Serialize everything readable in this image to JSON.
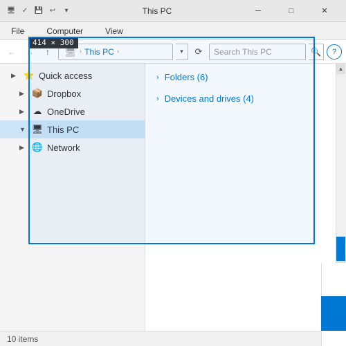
{
  "titleBar": {
    "title": "This PC",
    "minBtn": "─",
    "maxBtn": "□",
    "closeBtn": "✕"
  },
  "ribbon": {
    "tabs": [
      "File",
      "Computer",
      "View"
    ]
  },
  "addressBar": {
    "backLabel": "←",
    "forwardLabel": "→",
    "upLabel": "↑",
    "pathIcon": "🖥",
    "thisPcLabel": "This PC",
    "chevron": ">",
    "dropdownArrow": "▾",
    "refreshLabel": "⟳",
    "searchPlaceholder": "Search This PC",
    "searchIconLabel": "🔍",
    "helpLabel": "?"
  },
  "sidebar": {
    "items": [
      {
        "label": "Quick access",
        "icon": "⭐",
        "indent": false,
        "selected": false,
        "expanded": true
      },
      {
        "label": "Dropbox",
        "icon": "📦",
        "indent": true,
        "selected": false
      },
      {
        "label": "OneDrive",
        "icon": "☁",
        "indent": true,
        "selected": false
      },
      {
        "label": "This PC",
        "icon": "🖥",
        "indent": true,
        "selected": true
      },
      {
        "label": "Network",
        "icon": "🌐",
        "indent": true,
        "selected": false
      }
    ]
  },
  "fileArea": {
    "sections": [
      {
        "title": "Folders (6)",
        "chevron": ">"
      },
      {
        "title": "Devices and drives (4)",
        "chevron": ">"
      }
    ]
  },
  "selectionOverlay": {
    "sizeLabel": "414 × 300"
  },
  "statusBar": {
    "itemCount": "10 items"
  }
}
